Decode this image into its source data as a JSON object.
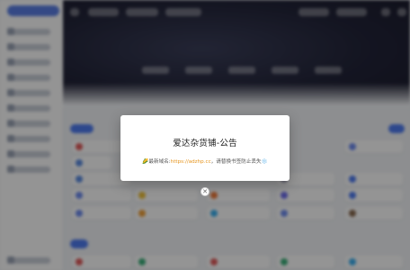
{
  "modal": {
    "title": "爱达杂货铺-公告",
    "leading_icon": "🌽",
    "prefix": "最新域名:",
    "url": "https://adzhp.cc",
    "suffix": "，请替换书签防止丢失",
    "trailing_icon": "❄️"
  },
  "close_button": {
    "label": "✕",
    "icon": "close-icon"
  },
  "colors": {
    "overlay": "rgba(0,0,0,0.42)",
    "url_color": "#e6951e",
    "accent_blue": "#4f7cf2"
  }
}
